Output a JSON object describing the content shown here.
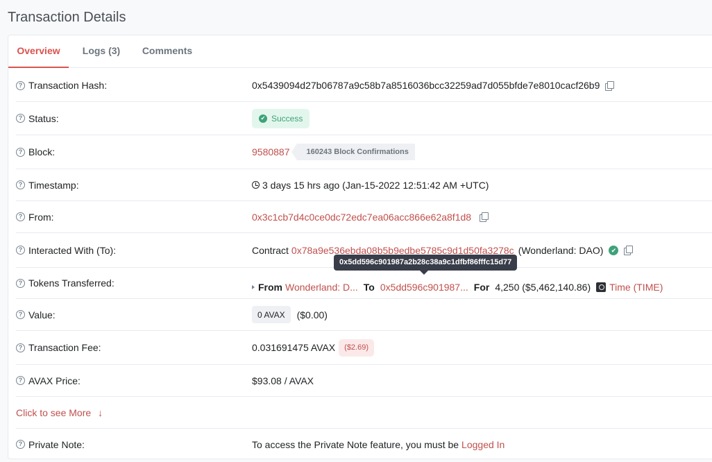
{
  "page": {
    "title": "Transaction Details"
  },
  "tabs": [
    {
      "label": "Overview"
    },
    {
      "label": "Logs (3)"
    },
    {
      "label": "Comments"
    }
  ],
  "rows": {
    "hash": {
      "label": "Transaction Hash:",
      "value": "0x5439094d27b06787a9c58b7a8516036bcc32259ad7d055bfde7e8010cacf26b9"
    },
    "status": {
      "label": "Status:",
      "value": "Success"
    },
    "block": {
      "label": "Block:",
      "number": "9580887",
      "confirmations": "160243 Block Confirmations"
    },
    "timestamp": {
      "label": "Timestamp:",
      "value": "3 days 15 hrs ago (Jan-15-2022 12:51:42 AM +UTC)"
    },
    "from": {
      "label": "From:",
      "value": "0x3c1cb7d4c0ce0dc72edc7ea06acc866e62a8f1d8"
    },
    "interacted": {
      "label": "Interacted With (To):",
      "prefix": "Contract",
      "address": "0x78a9e536ebda08b5b9edbe5785c9d1d50fa3278c",
      "name": "(Wonderland: DAO)"
    },
    "tokens": {
      "label": "Tokens Transferred:",
      "from_label": "From",
      "from_value": "Wonderland: D...",
      "to_label": "To",
      "to_value": "0x5dd596c901987...",
      "for_label": "For",
      "amount": "4,250 ($5,462,140.86)",
      "token": "Time (TIME)",
      "tooltip": "0x5dd596c901987a2b28c38a9c1dfbf86fffc15d77"
    },
    "value": {
      "label": "Value:",
      "badge": "0 AVAX",
      "usd": "($0.00)"
    },
    "fee": {
      "label": "Transaction Fee:",
      "value": "0.031691475 AVAX",
      "usd": "($2.69)"
    },
    "price": {
      "label": "AVAX Price:",
      "value": "$93.08 / AVAX"
    },
    "see_more": {
      "label": "Click to see More"
    },
    "note": {
      "label": "Private Note:",
      "text": "To access the Private Note feature, you must be",
      "link": "Logged In"
    }
  },
  "icons": {
    "help": "question-circle-icon",
    "copy": "copy-icon",
    "success": "check-circle-icon",
    "clock": "clock-icon",
    "verified": "verified-icon",
    "token": "token-logo-icon",
    "arrow": "arrow-down-icon"
  },
  "colors": {
    "accent": "#c0504d",
    "success": "#3ea27a",
    "text": "#1e2022",
    "muted": "#6c757e"
  }
}
